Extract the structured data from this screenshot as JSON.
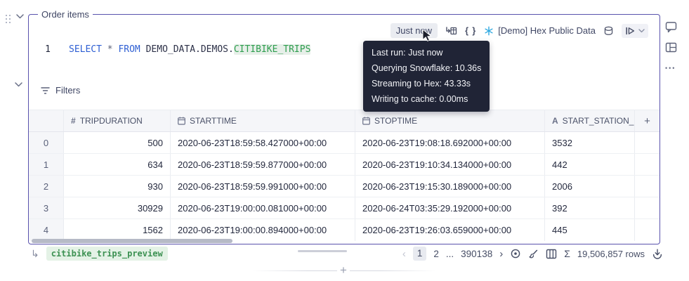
{
  "cell": {
    "title": "Order items",
    "toolbar": {
      "last_run": "Just now",
      "braces_glyph": "{ }",
      "connection": "[Demo] Hex Public Data"
    },
    "tooltip": {
      "line1": "Last run: Just now",
      "line2": "Querying Snowflake: 10.36s",
      "line3": "Streaming to Hex: 43.33s",
      "line4": "Writing to cache: 0.00ms"
    },
    "editor": {
      "line_number": "1",
      "kw_select": "SELECT",
      "star": "*",
      "kw_from": "FROM",
      "schema_path": "DEMO_DATA.DEMOS.",
      "table_name": "CITIBIKE_TRIPS"
    },
    "filters": {
      "label": "Filters"
    },
    "table": {
      "headers": {
        "number_glyph": "#",
        "string_glyph": "A",
        "tripduration": "TRIPDURATION",
        "starttime": "STARTTIME",
        "stoptime": "STOPTIME",
        "start_station": "START_STATION_",
        "add_column": "+"
      },
      "rows": [
        {
          "idx": "0",
          "tripduration": "500",
          "starttime": "2020-06-23T18:59:58.427000+00:00",
          "stoptime": "2020-06-23T19:08:18.692000+00:00",
          "station": "3532"
        },
        {
          "idx": "1",
          "tripduration": "634",
          "starttime": "2020-06-23T18:59:59.877000+00:00",
          "stoptime": "2020-06-23T19:10:34.134000+00:00",
          "station": "442"
        },
        {
          "idx": "2",
          "tripduration": "930",
          "starttime": "2020-06-23T18:59:59.991000+00:00",
          "stoptime": "2020-06-23T19:15:30.189000+00:00",
          "station": "2006"
        },
        {
          "idx": "3",
          "tripduration": "30929",
          "starttime": "2020-06-23T19:00:00.081000+00:00",
          "stoptime": "2020-06-24T03:35:29.192000+00:00",
          "station": "392"
        },
        {
          "idx": "4",
          "tripduration": "1562",
          "starttime": "2020-06-23T19:00:00.894000+00:00",
          "stoptime": "2020-06-23T19:26:03.659000+00:00",
          "station": "445"
        }
      ]
    },
    "footer": {
      "result_variable": "citibike_trips_preview",
      "return_glyph": "↳",
      "pagination": {
        "prev": "‹",
        "p1": "1",
        "p2": "2",
        "ellipsis": "...",
        "last": "390138",
        "next": "›"
      },
      "sigma_glyph": "Σ",
      "row_count": "19,506,857 rows"
    },
    "add_cell_glyph": "+",
    "more_glyph": "•••"
  },
  "colors": {
    "cell_border": "#5952ad",
    "snowflake_blue": "#2fa9e0",
    "sql_keyword": "#2e5fd3",
    "sql_table_green": "#2f9e4f",
    "tooltip_bg": "#202436",
    "badge_green_bg": "#e4f2e6"
  }
}
